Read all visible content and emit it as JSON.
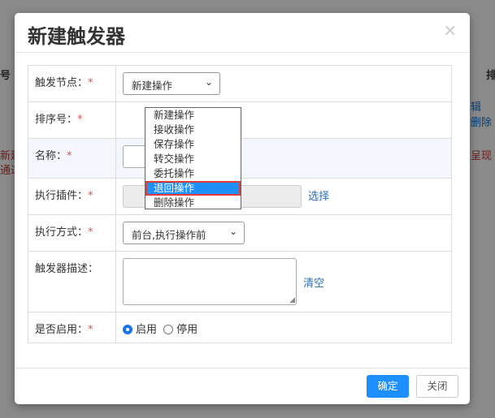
{
  "background": {
    "header_left": "号",
    "header_right": "排",
    "row_link": "辑 删除",
    "row_left_1": "新建",
    "row_left_2": "通过",
    "row_right": "呈现"
  },
  "modal": {
    "title": "新建触发器",
    "close_symbol": "×"
  },
  "form": {
    "trigger_node": {
      "label": "触发节点：",
      "required": "*",
      "value": "新建操作",
      "options": [
        "新建操作",
        "接收操作",
        "保存操作",
        "转交操作",
        "委托操作",
        "退回操作",
        "删除操作"
      ],
      "highlighted_option": "退回操作"
    },
    "sort_no": {
      "label": "排序号：",
      "required": "*"
    },
    "name": {
      "label": "名称：",
      "required": "*"
    },
    "plugin": {
      "label": "执行插件：",
      "required": "*",
      "select_link": "选择"
    },
    "exec_mode": {
      "label": "执行方式：",
      "required": "*",
      "value": "前台,执行操作前"
    },
    "description": {
      "label": "触发器描述：",
      "clear_link": "清空"
    },
    "enabled": {
      "label": "是否启用：",
      "required": "*",
      "option_on": "启用",
      "option_off": "停用",
      "selected": "启用"
    }
  },
  "footer": {
    "confirm_label": "确定",
    "close_label": "关闭"
  },
  "colors": {
    "primary": "#1e8fff",
    "required": "#d9534f",
    "highlight_outline": "#e53935"
  }
}
